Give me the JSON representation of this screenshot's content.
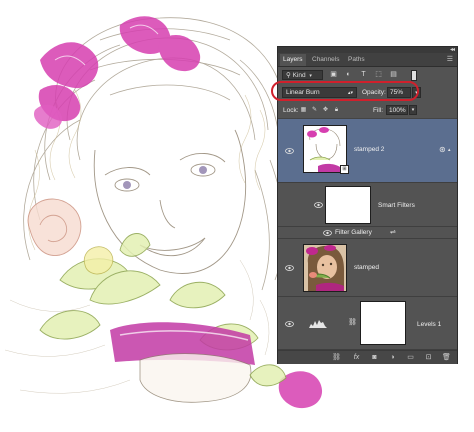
{
  "panel": {
    "tabs": [
      "Layers",
      "Channels",
      "Paths"
    ],
    "filter": {
      "kind_label": "Kind"
    },
    "blend_mode": "Linear Burn",
    "opacity_label": "Opacity:",
    "opacity_value": "75%",
    "lock_label": "Lock:",
    "fill_label": "Fill:",
    "fill_value": "100%",
    "layers": [
      {
        "name": "stamped 2",
        "selected": true
      },
      {
        "name": "Smart Filters",
        "selected": false
      },
      {
        "name": "Filter Gallery",
        "selected": false
      },
      {
        "name": "stamped",
        "selected": false
      },
      {
        "name": "Levels 1",
        "selected": false
      }
    ],
    "bottom_icons": [
      "link-icon",
      "fx-icon",
      "mask-icon",
      "adjustment-icon",
      "group-icon",
      "new-layer-icon",
      "trash-icon"
    ]
  },
  "colors": {
    "panel_bg": "#535353",
    "selected_row": "#5b6e8f",
    "highlight_ring": "#d0202c"
  }
}
